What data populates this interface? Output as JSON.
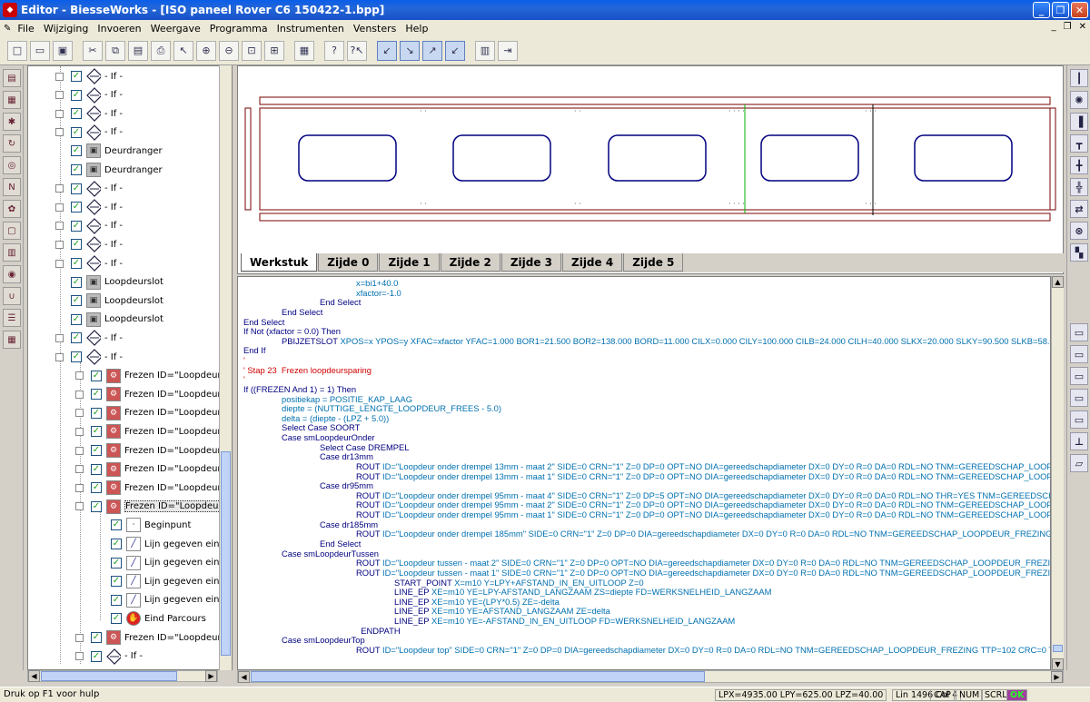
{
  "window": {
    "title": "Editor - BiesseWorks - [ISO paneel Rover C6 150422-1.bpp]"
  },
  "menu": [
    "File",
    "Wijziging",
    "Invoeren",
    "Weergave",
    "Programma",
    "Instrumenten",
    "Vensters",
    "Help"
  ],
  "toolbar": {
    "icons": [
      "new-file",
      "open-folder",
      "save",
      "cut",
      "copy",
      "paste",
      "print",
      "pointer",
      "zoom-in",
      "zoom-out",
      "zoom-window",
      "zoom-all",
      "color-palette",
      "help",
      "help-context",
      "tool-1",
      "tool-2",
      "tool-3",
      "tool-4",
      "books",
      "exit-door"
    ]
  },
  "tree": {
    "items": [
      {
        "label": "- If -",
        "icon": "diamond",
        "expander": "+",
        "level": 0
      },
      {
        "label": "- If -",
        "icon": "diamond",
        "expander": "+",
        "level": 0
      },
      {
        "label": "- If -",
        "icon": "diamond",
        "expander": "+",
        "level": 0
      },
      {
        "label": "- If -",
        "icon": "diamond",
        "expander": "+",
        "level": 0
      },
      {
        "label": "Deurdranger",
        "icon": "door",
        "expander": "",
        "level": 0
      },
      {
        "label": "Deurdranger",
        "icon": "door",
        "expander": "",
        "level": 0
      },
      {
        "label": "- If -",
        "icon": "diamond",
        "expander": "+",
        "level": 0
      },
      {
        "label": "- If -",
        "icon": "diamond",
        "expander": "+",
        "level": 0
      },
      {
        "label": "- If -",
        "icon": "diamond",
        "expander": "+",
        "level": 0
      },
      {
        "label": "- If -",
        "icon": "diamond",
        "expander": "+",
        "level": 0
      },
      {
        "label": "- If -",
        "icon": "diamond",
        "expander": "+",
        "level": 0
      },
      {
        "label": "Loopdeurslot",
        "icon": "door",
        "expander": "",
        "level": 0
      },
      {
        "label": "Loopdeurslot",
        "icon": "door",
        "expander": "",
        "level": 0
      },
      {
        "label": "Loopdeurslot",
        "icon": "door",
        "expander": "",
        "level": 0
      },
      {
        "label": "- If -",
        "icon": "diamond",
        "expander": "+",
        "level": 0
      },
      {
        "label": "- If -",
        "icon": "diamond",
        "expander": "-",
        "level": 0
      },
      {
        "label": "Frezen ID=\"Loopdeur o",
        "icon": "mill",
        "expander": "+",
        "level": 1
      },
      {
        "label": "Frezen ID=\"Loopdeur o",
        "icon": "mill",
        "expander": "+",
        "level": 1
      },
      {
        "label": "Frezen ID=\"Loopdeur o",
        "icon": "mill",
        "expander": "+",
        "level": 1
      },
      {
        "label": "Frezen ID=\"Loopdeur o",
        "icon": "mill",
        "expander": "+",
        "level": 1
      },
      {
        "label": "Frezen ID=\"Loopdeur o",
        "icon": "mill",
        "expander": "+",
        "level": 1
      },
      {
        "label": "Frezen ID=\"Loopdeur o",
        "icon": "mill",
        "expander": "+",
        "level": 1
      },
      {
        "label": "Frezen ID=\"Loopdeur t",
        "icon": "mill",
        "expander": "+",
        "level": 1
      },
      {
        "label": "Frezen ID=\"Loopdeur t",
        "icon": "mill",
        "expander": "-",
        "level": 1
      },
      {
        "label": "Beginpunt",
        "icon": "pt",
        "expander": "",
        "level": 2
      },
      {
        "label": "Lijn gegeven einc",
        "icon": "line",
        "expander": "",
        "level": 2
      },
      {
        "label": "Lijn gegeven einc",
        "icon": "line",
        "expander": "",
        "level": 2
      },
      {
        "label": "Lijn gegeven einc",
        "icon": "line",
        "expander": "",
        "level": 2
      },
      {
        "label": "Lijn gegeven einc",
        "icon": "line",
        "expander": "",
        "level": 2
      },
      {
        "label": "Eind Parcours",
        "icon": "stop",
        "expander": "",
        "level": 2
      },
      {
        "label": "Frezen ID=\"Loopdeur t",
        "icon": "mill",
        "expander": "+",
        "level": 1
      },
      {
        "label": "- If -",
        "icon": "diamond",
        "expander": "+",
        "level": 1
      }
    ]
  },
  "tabs": [
    "Werkstuk",
    "Zijde 0",
    "Zijde 1",
    "Zijde 2",
    "Zijde 3",
    "Zijde 4",
    "Zijde 5"
  ],
  "code": [
    {
      "indent": 3,
      "parts": [
        [
          "fn",
          "x=bi1+40.0"
        ]
      ]
    },
    {
      "indent": 3,
      "parts": [
        [
          "fn",
          "xfactor=-1.0"
        ]
      ]
    },
    {
      "indent": 2,
      "parts": [
        [
          "kw",
          "End Select"
        ]
      ]
    },
    {
      "indent": 1,
      "parts": [
        [
          "kw",
          "End Select"
        ]
      ]
    },
    {
      "indent": 0,
      "parts": [
        [
          "kw",
          "End Select"
        ]
      ]
    },
    {
      "indent": 0,
      "parts": [
        [
          "kw",
          "If Not (xfactor = 0.0) Then"
        ]
      ]
    },
    {
      "indent": 1,
      "parts": [
        [
          "kw",
          "PBIJZETSLOT "
        ],
        [
          "fn",
          "XPOS=x YPOS=y XFAC=xfactor YFAC=1.000 BOR1=21.500 BOR2=138.000 BORD=11.000 CILX=0.000 CILY=100.000 CILB=24.000 CILH=40.000 SLKX=20.000 SLKY=90.500 SLKB=58.000 S"
        ]
      ]
    },
    {
      "indent": 0,
      "parts": [
        [
          "kw",
          "End If"
        ]
      ]
    },
    {
      "indent": 0,
      "parts": [
        [
          "red",
          "'"
        ]
      ]
    },
    {
      "indent": 0,
      "parts": [
        [
          "red",
          "' Stap 23  Frezen loopdeursparing"
        ]
      ]
    },
    {
      "indent": 0,
      "parts": [
        [
          "red",
          "'"
        ]
      ]
    },
    {
      "indent": 0,
      "parts": [
        [
          "kw",
          "If ((FREZEN And 1) = 1) Then"
        ]
      ]
    },
    {
      "indent": 1,
      "parts": [
        [
          "fn",
          "positiekap = POSITIE_KAP_LAAG"
        ]
      ]
    },
    {
      "indent": 1,
      "parts": [
        [
          "fn",
          "diepte = (NUTTIGE_LENGTE_LOOPDEUR_FREES - 5.0)"
        ]
      ]
    },
    {
      "indent": 1,
      "parts": [
        [
          "fn",
          "delta = (diepte - (LPZ + 5.0))"
        ]
      ]
    },
    {
      "indent": 1,
      "parts": [
        [
          "kw",
          "Select Case SOORT"
        ]
      ]
    },
    {
      "indent": 1,
      "parts": [
        [
          "kw",
          "Case smLoopdeurOnder"
        ]
      ]
    },
    {
      "indent": 2,
      "parts": [
        [
          "kw",
          "Select Case DREMPEL"
        ]
      ]
    },
    {
      "indent": 2,
      "parts": [
        [
          "kw",
          "Case dr13mm"
        ]
      ]
    },
    {
      "indent": 3,
      "parts": [
        [
          "kw",
          "ROUT "
        ],
        [
          "fn",
          "ID=\"Loopdeur onder drempel 13mm - maat 2\" SIDE=0 CRN=\"1\" Z=0 DP=0 OPT=NO DIA=gereedschapdiameter DX=0 DY=0 R=0 DA=0 RDL=NO TNM=GEREEDSCHAP_LOOPDE"
        ]
      ]
    },
    {
      "indent": 3,
      "parts": [
        [
          "kw",
          "ROUT "
        ],
        [
          "fn",
          "ID=\"Loopdeur onder drempel 13mm - maat 1\" SIDE=0 CRN=\"1\" Z=0 DP=0 OPT=NO DIA=gereedschapdiameter DX=0 DY=0 R=0 DA=0 RDL=NO TNM=GEREEDSCHAP_LOOPDE"
        ]
      ]
    },
    {
      "indent": 2,
      "parts": [
        [
          "kw",
          "Case dr95mm"
        ]
      ]
    },
    {
      "indent": 3,
      "parts": [
        [
          "kw",
          "ROUT "
        ],
        [
          "fn",
          "ID=\"Loopdeur onder drempel 95mm - maat 4\" SIDE=0 CRN=\"1\" Z=0 DP=5 OPT=NO DIA=gereedschapdiameter DX=0 DY=0 R=0 DA=0 RDL=NO THR=YES TNM=GEREEDSCHAF"
        ]
      ]
    },
    {
      "indent": 3,
      "parts": [
        [
          "kw",
          "ROUT "
        ],
        [
          "fn",
          "ID=\"Loopdeur onder drempel 95mm - maat 2\" SIDE=0 CRN=\"1\" Z=0 DP=0 OPT=NO DIA=gereedschapdiameter DX=0 DY=0 R=0 DA=0 RDL=NO TNM=GEREEDSCHAP_LOOPDE"
        ]
      ]
    },
    {
      "indent": 3,
      "parts": [
        [
          "kw",
          "ROUT "
        ],
        [
          "fn",
          "ID=\"Loopdeur onder drempel 95mm - maat 1\" SIDE=0 CRN=\"1\" Z=0 DP=0 OPT=NO DIA=gereedschapdiameter DX=0 DY=0 R=0 DA=0 RDL=NO TNM=GEREEDSCHAP_LOOPDE"
        ]
      ]
    },
    {
      "indent": 2,
      "parts": [
        [
          "kw",
          "Case dr185mm"
        ]
      ]
    },
    {
      "indent": 3,
      "parts": [
        [
          "kw",
          "ROUT "
        ],
        [
          "fn",
          "ID=\"Loopdeur onder drempel 185mm\" SIDE=0 CRN=\"1\" Z=0 DP=0 DIA=gereedschapdiameter DX=0 DY=0 R=0 DA=0 RDL=NO TNM=GEREEDSCHAP_LOOPDEUR_FREZING T1"
        ]
      ]
    },
    {
      "indent": 2,
      "parts": [
        [
          "kw",
          "End Select"
        ]
      ]
    },
    {
      "indent": 1,
      "parts": [
        [
          "kw",
          "Case smLoopdeurTussen"
        ]
      ]
    },
    {
      "indent": 3,
      "parts": [
        [
          "kw",
          "ROUT "
        ],
        [
          "fn",
          "ID=\"Loopdeur tussen - maat 2\" SIDE=0 CRN=\"1\" Z=0 DP=0 OPT=NO DIA=gereedschapdiameter DX=0 DY=0 R=0 DA=0 RDL=NO TNM=GEREEDSCHAP_LOOPDEUR_FREZING"
        ]
      ]
    },
    {
      "indent": 3,
      "parts": [
        [
          "kw",
          "ROUT "
        ],
        [
          "fn",
          "ID=\"Loopdeur tussen - maat 1\" SIDE=0 CRN=\"1\" Z=0 DP=0 OPT=NO DIA=gereedschapdiameter DX=0 DY=0 R=0 DA=0 RDL=NO TNM=GEREEDSCHAP_LOOPDEUR_FREZING"
        ]
      ]
    },
    {
      "indent": 4,
      "parts": [
        [
          "kw",
          "START_POINT "
        ],
        [
          "fn",
          "X=m10 Y=LPY+AFSTAND_IN_EN_UITLOOP Z=0"
        ]
      ]
    },
    {
      "indent": 4,
      "parts": [
        [
          "kw",
          "LINE_EP "
        ],
        [
          "fn",
          "XE=m10 YE=LPY-AFSTAND_LANGZAAM ZS=diepte FD=WERKSNELHEID_LANGZAAM"
        ]
      ]
    },
    {
      "indent": 4,
      "parts": [
        [
          "kw",
          "LINE_EP "
        ],
        [
          "fn",
          "XE=m10 YE=(LPY*0.5) ZE=-delta"
        ]
      ]
    },
    {
      "indent": 4,
      "parts": [
        [
          "kw",
          "LINE_EP "
        ],
        [
          "fn",
          "XE=m10 YE=AFSTAND_LANGZAAM ZE=delta"
        ]
      ]
    },
    {
      "indent": 4,
      "parts": [
        [
          "kw",
          "LINE_EP "
        ],
        [
          "fn",
          "XE=m10 YE=-AFSTAND_IN_EN_UITLOOP FD=WERKSNELHEID_LANGZAAM"
        ]
      ]
    },
    {
      "indent": 3,
      "parts": [
        [
          "kw",
          "  ENDPATH"
        ]
      ]
    },
    {
      "indent": 1,
      "parts": [
        [
          "kw",
          "Case smLoopdeurTop"
        ]
      ]
    },
    {
      "indent": 3,
      "parts": [
        [
          "kw",
          "ROUT "
        ],
        [
          "fn",
          "ID=\"Loopdeur top\" SIDE=0 CRN=\"1\" Z=0 DP=0 DIA=gereedschapdiameter DX=0 DY=0 R=0 DA=0 RDL=NO TNM=GEREEDSCHAP_LOOPDEUR_FREZING TTP=102 CRC=0 TIN"
        ]
      ]
    }
  ],
  "status": {
    "help": "Druk op F1 voor hulp",
    "coords": "LPX=4935.00  LPY=625.00  LPZ=40.00",
    "pos": "Lin 1496  Col 4",
    "cap": "CAP",
    "num": "NUM",
    "scrl": "SCRL",
    "ok": "OK"
  }
}
